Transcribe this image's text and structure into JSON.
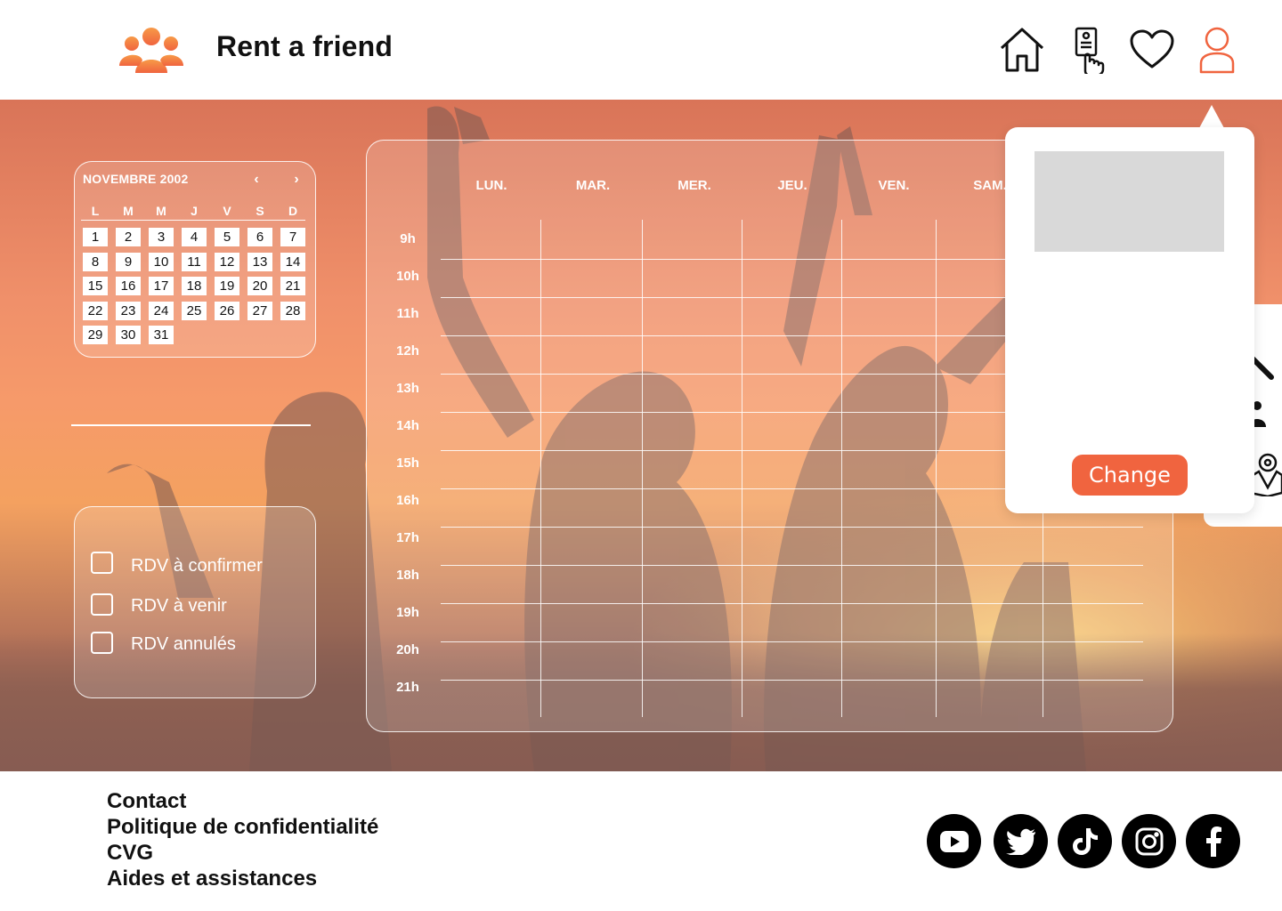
{
  "header": {
    "brand": "Rent a friend",
    "nav": [
      {
        "icon": "home-icon"
      },
      {
        "icon": "rent-card-icon"
      },
      {
        "icon": "heart-icon"
      },
      {
        "icon": "user-icon",
        "active": true
      }
    ],
    "accent": "#f0643f"
  },
  "mini_calendar": {
    "title": "NOVEMBRE 2002",
    "prev": "‹",
    "next": "›",
    "weekdays": [
      "L",
      "M",
      "M",
      "J",
      "V",
      "S",
      "D"
    ],
    "days": [
      "1",
      "2",
      "3",
      "4",
      "5",
      "6",
      "7",
      "8",
      "9",
      "10",
      "11",
      "12",
      "13",
      "14",
      "15",
      "16",
      "17",
      "18",
      "19",
      "20",
      "21",
      "22",
      "23",
      "24",
      "25",
      "26",
      "27",
      "28",
      "29",
      "30",
      "31"
    ]
  },
  "filters": [
    {
      "label": "RDV à confirmer",
      "checked": false
    },
    {
      "label": "RDV à venir",
      "checked": false
    },
    {
      "label": "RDV annulés",
      "checked": false
    }
  ],
  "week": {
    "days": [
      "LUN.",
      "MAR.",
      "MER.",
      "JEU.",
      "VEN.",
      "SAM."
    ],
    "hours": [
      "9h",
      "10h",
      "11h",
      "12h",
      "13h",
      "14h",
      "15h",
      "16h",
      "17h",
      "18h",
      "19h",
      "20h",
      "21h"
    ]
  },
  "popup": {
    "button": "Change"
  },
  "footer": {
    "links": [
      "Contact",
      "Politique de confidentialité",
      "CVG",
      "Aides et assistances"
    ],
    "social": [
      "youtube-icon",
      "twitter-icon",
      "tiktok-icon",
      "instagram-icon",
      "facebook-icon"
    ]
  }
}
